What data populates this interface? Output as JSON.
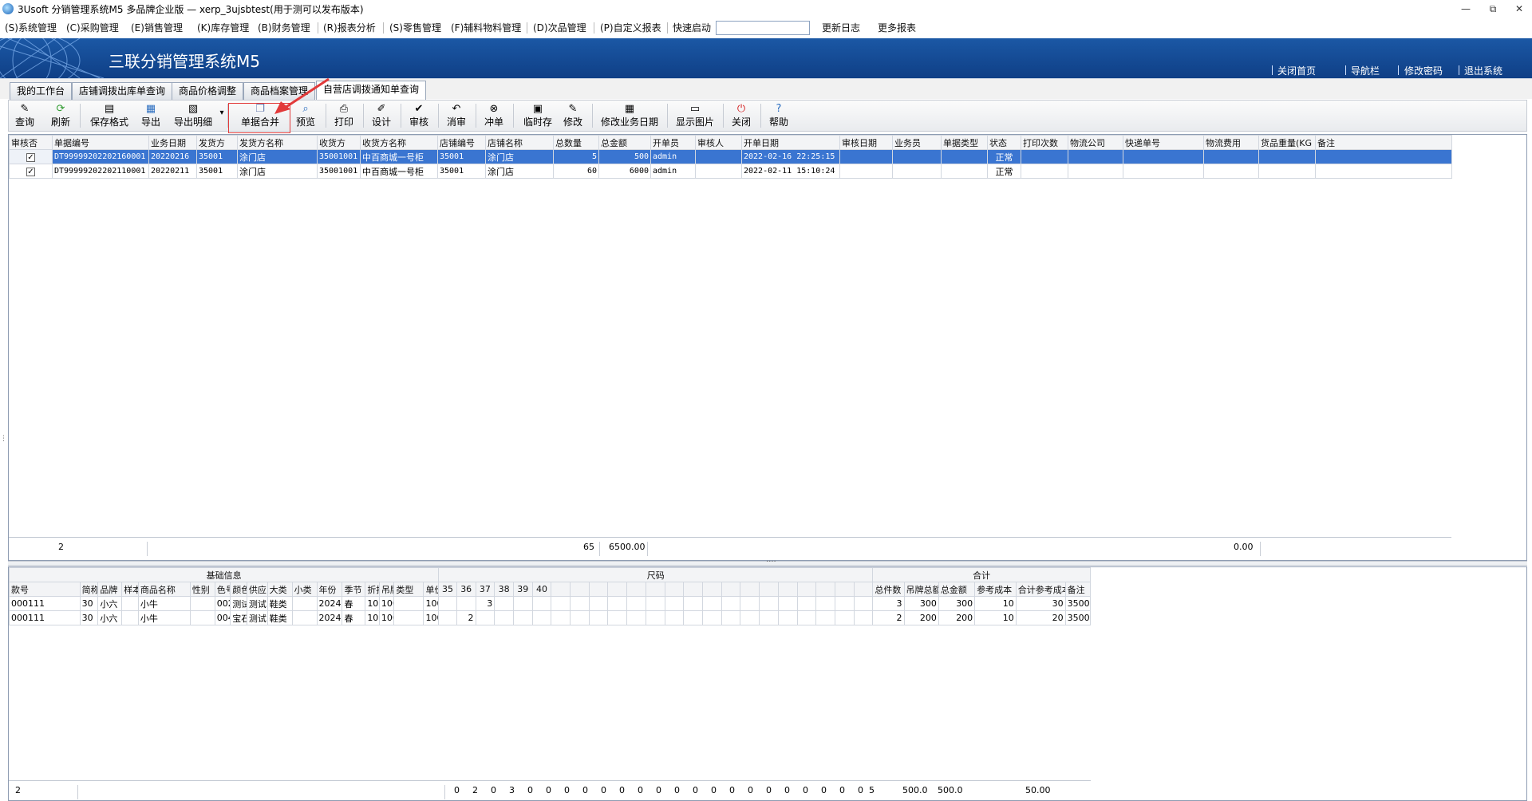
{
  "window": {
    "title": "3Usoft 分销管理系统M5 多品牌企业版 — xerp_3ujsbtest(用于测可以发布版本)",
    "controls": [
      "—",
      "⧉",
      "✕"
    ]
  },
  "menu": {
    "items": [
      "(S)系统管理",
      "(C)采购管理",
      "(E)销售管理",
      "(K)库存管理",
      "(B)财务管理",
      "(R)报表分析",
      "(S)零售管理",
      "(F)辅料物料管理",
      "(D)次品管理",
      "(P)自定义报表"
    ],
    "quick_label": "快速启动",
    "quick_value": "",
    "update_log": "更新日志",
    "more_reports": "更多报表"
  },
  "banner": {
    "title": "三联分销管理系统M5",
    "links": [
      "关闭首页",
      "导航栏",
      "修改密码",
      "退出系统"
    ]
  },
  "tabs": [
    "我的工作台",
    "店铺调拨出库单查询",
    "商品价格调整",
    "商品档案管理",
    "自营店调拨通知单查询"
  ],
  "toolbar": {
    "buttons": [
      "查询",
      "刷新",
      "保存格式",
      "导出",
      "导出明细",
      "单据合并",
      "预览",
      "打印",
      "设计",
      "审核",
      "消审",
      "冲单",
      "临时存",
      "修改",
      "修改业务日期",
      "显示图片",
      "关闭",
      "帮助"
    ],
    "dropdown_caret": "▾"
  },
  "icons": {
    "query": "pencil-icon",
    "refresh": "refresh-icon",
    "save_format": "save-icon",
    "export": "export-icon",
    "export_detail": "export-detail-icon",
    "merge": "merge-icon",
    "preview": "preview-icon",
    "print": "printer-icon",
    "design": "design-icon",
    "audit": "check-icon",
    "unaudit": "undo-icon",
    "reverse": "cancel-icon",
    "temp_save": "temp-save-icon",
    "modify": "edit-icon",
    "modify_date": "calendar-edit-icon",
    "show_image": "image-icon",
    "close": "power-icon",
    "help": "help-icon"
  },
  "colors": {
    "banner": "#1b58a5",
    "selected_row": "#3a75d1",
    "highlight_box": "#e23a3a",
    "close_icon": "#d42020",
    "refresh_icon": "#2e9a2e"
  },
  "top_grid": {
    "headers": [
      "审核否",
      "单据编号",
      "业务日期",
      "发货方",
      "发货方名称",
      "收货方",
      "收货方名称",
      "店铺编号",
      "店铺名称",
      "总数量",
      "总金额",
      "开单员",
      "审核人",
      "开单日期",
      "审核日期",
      "业务员",
      "单据类型",
      "状态",
      "打印次数",
      "物流公司",
      "快递单号",
      "物流费用",
      "货品重量(KG",
      "备注"
    ],
    "rows": [
      {
        "checked": "✓",
        "no": "DT99999202202160001",
        "date": "20220216",
        "from": "35001",
        "from_name": "涂门店",
        "to": "35001001",
        "to_name": "中百商城一号柜",
        "shop_no": "35001",
        "shop_name": "涂门店",
        "qty": "5",
        "amount": "500",
        "creator": "admin",
        "auditor": "",
        "created": "2022-02-16 22:25:15",
        "audit_date": "",
        "salesman": "",
        "type": "",
        "status": "正常",
        "prints": "",
        "logistics": "",
        "express": "",
        "fee": "",
        "weight": "",
        "note": ""
      },
      {
        "checked": "✓",
        "no": "DT99999202202110001",
        "date": "20220211",
        "from": "35001",
        "from_name": "涂门店",
        "to": "35001001",
        "to_name": "中百商城一号柜",
        "shop_no": "35001",
        "shop_name": "涂门店",
        "qty": "60",
        "amount": "6000",
        "creator": "admin",
        "auditor": "",
        "created": "2022-02-11 15:10:24",
        "audit_date": "",
        "salesman": "",
        "type": "",
        "status": "正常",
        "prints": "",
        "logistics": "",
        "express": "",
        "fee": "",
        "weight": "",
        "note": ""
      }
    ],
    "summary": {
      "count": "2",
      "qty": "65",
      "amount": "6500.00",
      "fee": "0.00"
    }
  },
  "bottom_grid": {
    "group_headers": [
      "基础信息",
      "尺码",
      "合计"
    ],
    "headers": [
      "款号",
      "简称",
      "品牌",
      "样本",
      "商品名称",
      "性别",
      "色号",
      "颜色",
      "供应",
      "大类",
      "小类",
      "年份",
      "季节",
      "折扣",
      "吊牌",
      "类型",
      "单价"
    ],
    "size_headers": [
      "35",
      "36",
      "37",
      "38",
      "39",
      "40",
      "",
      "",
      "",
      "",
      "",
      "",
      "",
      "",
      "",
      "",
      "",
      "",
      "",
      "",
      "",
      "",
      ""
    ],
    "total_headers": [
      "总件数",
      "吊牌总额",
      "总金额",
      "参考成本",
      "合计参考成本",
      "备注"
    ],
    "rows": [
      {
        "base": [
          "000111",
          "30",
          "小六",
          "",
          "小牛",
          "",
          "002",
          "测试",
          "测试",
          "鞋类",
          "",
          "2024",
          "春",
          "10",
          "100",
          "",
          "100"
        ],
        "sizes": [
          "",
          "",
          "3",
          "",
          "",
          "",
          "",
          "",
          "",
          "",
          "",
          "",
          "",
          "",
          "",
          "",
          "",
          "",
          "",
          "",
          "",
          "",
          ""
        ],
        "totals": [
          "3",
          "300",
          "300",
          "10",
          "30",
          "3500"
        ]
      },
      {
        "base": [
          "000111",
          "30",
          "小六",
          "",
          "小牛",
          "",
          "004",
          "宝石",
          "测试",
          "鞋类",
          "",
          "2024",
          "春",
          "10",
          "100",
          "",
          "100"
        ],
        "sizes": [
          "",
          "2",
          "",
          "",
          "",
          "",
          "",
          "",
          "",
          "",
          "",
          "",
          "",
          "",
          "",
          "",
          "",
          "",
          "",
          "",
          "",
          "",
          ""
        ],
        "totals": [
          "2",
          "200",
          "200",
          "10",
          "20",
          "3500"
        ]
      }
    ],
    "summary": {
      "count": "2",
      "sizes": [
        "0",
        "2",
        "0",
        "3",
        "0",
        "0",
        "0",
        "0",
        "0",
        "0",
        "0",
        "0",
        "0",
        "0",
        "0",
        "0",
        "0",
        "0",
        "0",
        "0",
        "0",
        "0",
        "0"
      ],
      "totals": [
        "5",
        "500.0",
        "500.0",
        "",
        "50.00",
        ""
      ]
    }
  }
}
